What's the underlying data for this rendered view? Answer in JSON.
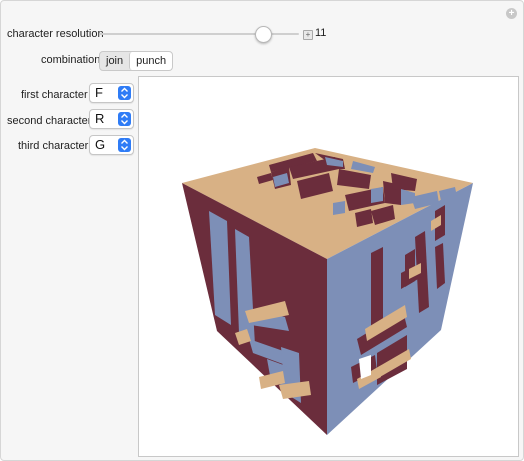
{
  "controls": {
    "resolution_label": "character resolution",
    "resolution_value": "11",
    "resolution_slider_fraction": 0.82,
    "combination_label": "combination",
    "combination_options": [
      "join",
      "punch"
    ],
    "combination_selected": "punch",
    "first_label": "first character",
    "first_value": "F",
    "second_label": "second character",
    "second_value": "R",
    "third_label": "third character",
    "third_value": "G"
  },
  "plot": {
    "face_colors": {
      "top": "#d8b185",
      "left": "#6b2d3c",
      "right": "#7d8fb7"
    }
  },
  "icons": {
    "corner": "plus-circle-icon",
    "slider_increment": "plus-square-icon",
    "select_arrows": "updown-chevron-icon"
  }
}
